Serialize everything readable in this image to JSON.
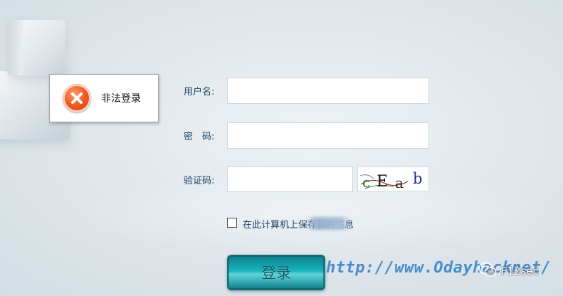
{
  "error": {
    "message": "非法登录",
    "icon": "close-circle-icon",
    "icon_color": "#f05a22"
  },
  "form": {
    "username_label": "用户名:",
    "password_label": "密　码:",
    "captcha_label": "验证码:",
    "username_value": "",
    "password_value": "",
    "captcha_value": "",
    "captcha_image_text": "cEab",
    "remember_text": "在此计算机上保存我的信息",
    "login_label": "登录"
  },
  "watermark": {
    "url_text": "http://www.Odayhacknet/",
    "wechat_text": "F12sec",
    "wechat_icon": "wechat-icon"
  },
  "colors": {
    "label": "#1b3f66",
    "button": "#1ab3bd",
    "watermark": "#3a84c8"
  }
}
